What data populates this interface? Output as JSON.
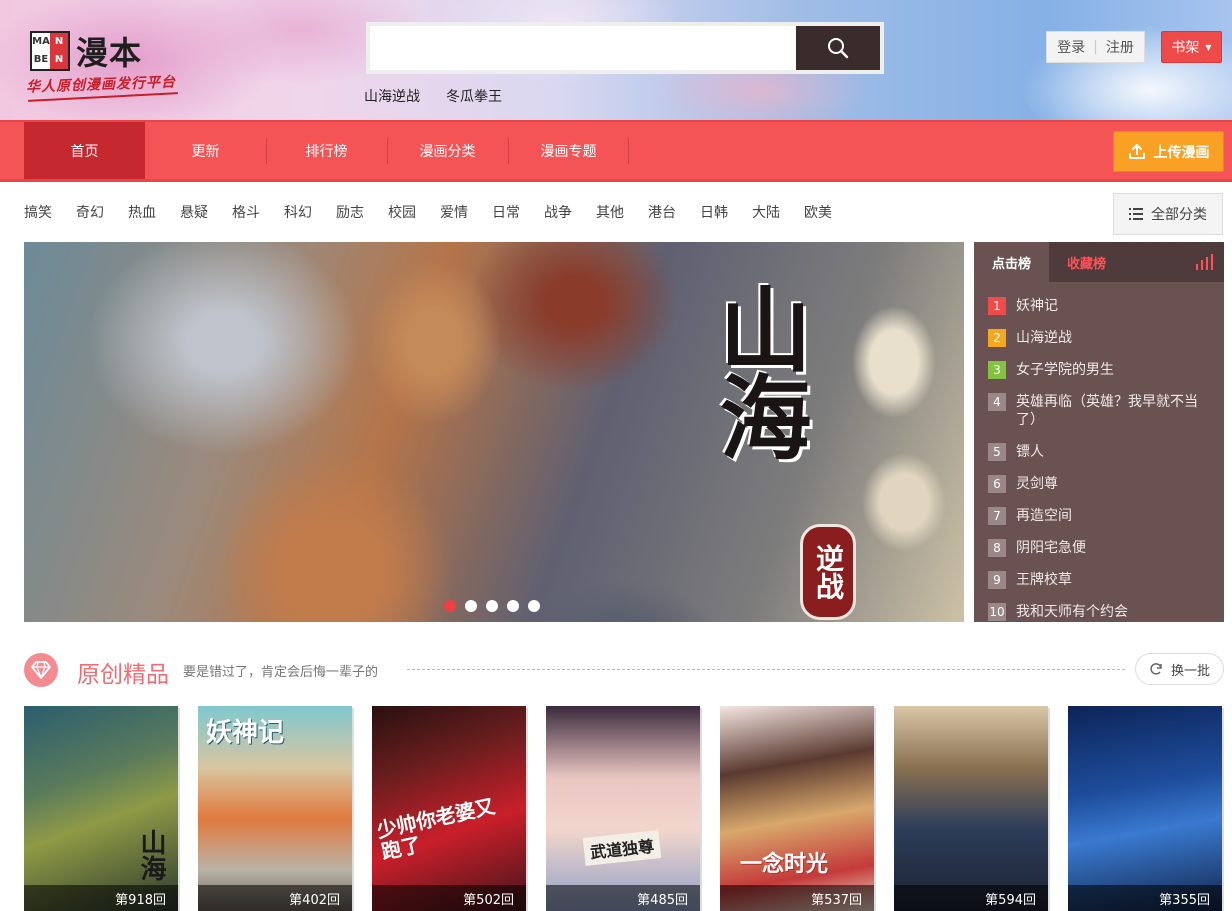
{
  "site": {
    "logo_box": [
      "MA",
      "N",
      "BE",
      "N"
    ],
    "logo_text": "漫本",
    "slogan": "华人原创漫画发行平台"
  },
  "search": {
    "value": "",
    "placeholder": "",
    "hot_words": [
      "山海逆战",
      "冬瓜拳王"
    ]
  },
  "auth": {
    "login": "登录",
    "register": "注册"
  },
  "shelf": {
    "label": "书架"
  },
  "nav": {
    "items": [
      "首页",
      "更新",
      "排行榜",
      "漫画分类",
      "漫画专题"
    ],
    "upload_label": "上传漫画"
  },
  "categories": [
    "搞笑",
    "奇幻",
    "热血",
    "悬疑",
    "格斗",
    "科幻",
    "励志",
    "校园",
    "爱情",
    "日常",
    "战争",
    "其他",
    "港台",
    "日韩",
    "大陆",
    "欧美"
  ],
  "all_categories_label": "全部分类",
  "banner": {
    "title": "山海",
    "subtitle": "逆战",
    "dots": 5,
    "active_dot": 0
  },
  "rank": {
    "tabs": [
      "点击榜",
      "收藏榜"
    ],
    "items": [
      {
        "num": "1",
        "title": "妖神记"
      },
      {
        "num": "2",
        "title": "山海逆战"
      },
      {
        "num": "3",
        "title": "女子学院的男生"
      },
      {
        "num": "4",
        "title": "英雄再临（英雄？我早就不当了）"
      },
      {
        "num": "5",
        "title": "镖人"
      },
      {
        "num": "6",
        "title": "灵剑尊"
      },
      {
        "num": "7",
        "title": "再造空间"
      },
      {
        "num": "8",
        "title": "阴阳宅急便"
      },
      {
        "num": "9",
        "title": "王牌校草"
      },
      {
        "num": "10",
        "title": "我和天师有个约会"
      }
    ]
  },
  "section": {
    "title": "原创精品",
    "desc": "要是错过了，肯定会后悔一辈子的",
    "refresh": "换一批"
  },
  "comics": [
    {
      "ep": "第918回",
      "cover_text": "山海"
    },
    {
      "ep": "第402回",
      "cover_text": "妖神记"
    },
    {
      "ep": "第502回",
      "cover_text": "少帅你老婆又跑了"
    },
    {
      "ep": "第485回",
      "cover_text": "武道独尊"
    },
    {
      "ep": "第537回",
      "cover_text": "一念时光"
    },
    {
      "ep": "第594回",
      "cover_text": ""
    },
    {
      "ep": "第355回",
      "cover_text": ""
    }
  ],
  "colors": {
    "nav_red": "#f55457",
    "nav_active": "#c5282f",
    "upload_orange": "#f9a124",
    "rank_bg": "#6a5252",
    "accent_pink": "#ef6d74"
  }
}
